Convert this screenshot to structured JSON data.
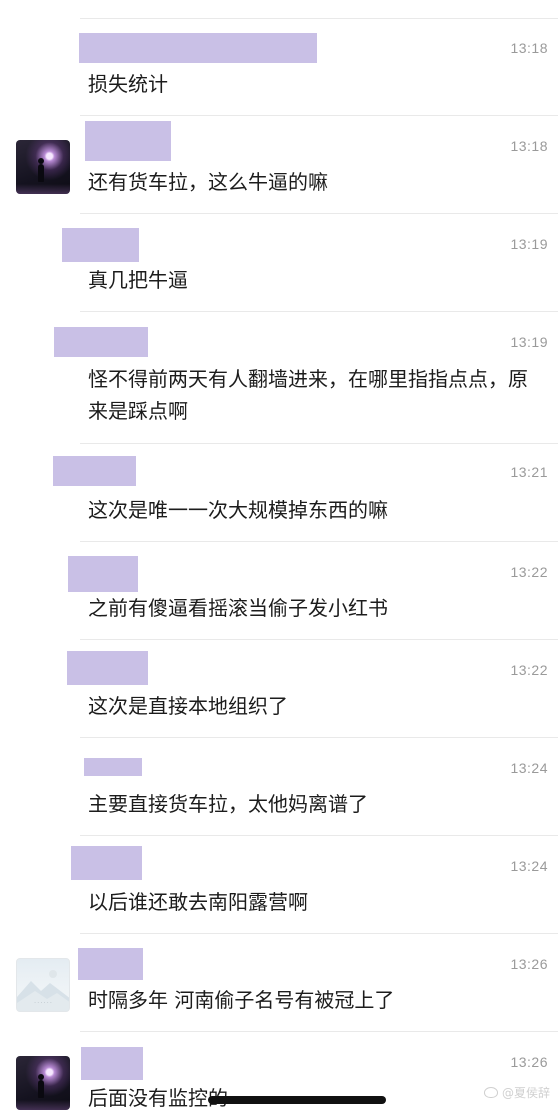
{
  "chat": {
    "messages": [
      {
        "avatar": "none",
        "time": "13:18",
        "text": "损失统计"
      },
      {
        "avatar": "night-photo",
        "time": "13:18",
        "text": "还有货车拉，这么牛逼的嘛"
      },
      {
        "avatar": "none",
        "time": "13:19",
        "text": "真几把牛逼"
      },
      {
        "avatar": "none",
        "time": "13:19",
        "text": "怪不得前两天有人翻墙进来，在哪里指指点点，原来是踩点啊"
      },
      {
        "avatar": "none",
        "time": "13:21",
        "text": "这次是唯一一次大规模掉东西的嘛"
      },
      {
        "avatar": "none",
        "time": "13:22",
        "text": "之前有傻逼看摇滚当偷子发小红书"
      },
      {
        "avatar": "none",
        "time": "13:22",
        "text": "这次是直接本地组织了"
      },
      {
        "avatar": "none",
        "time": "13:24",
        "text": "主要直接货车拉，太他妈离谱了"
      },
      {
        "avatar": "none",
        "time": "13:24",
        "text": "以后谁还敢去南阳露营啊"
      },
      {
        "avatar": "landscape-photo",
        "time": "13:26",
        "text": "时隔多年 河南偷子名号有被冠上了"
      },
      {
        "avatar": "night-photo",
        "time": "13:26",
        "text": "后面没有监控的"
      }
    ]
  },
  "watermark": {
    "text": "@夏侯辞",
    "icon": "weibo-icon"
  },
  "colors": {
    "redaction": "#c9c0e6",
    "timestamp": "#9a9a9a",
    "separator": "#e9e9e9"
  }
}
